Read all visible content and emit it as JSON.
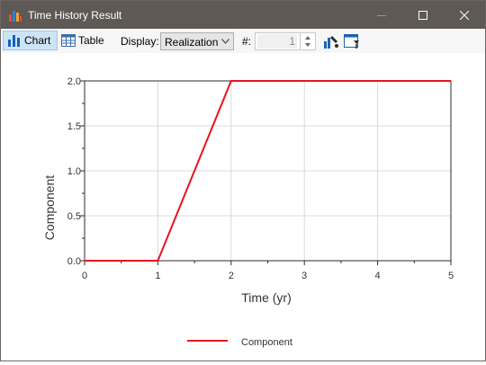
{
  "window": {
    "title": "Time History Result"
  },
  "toolbar": {
    "chart_label": "Chart",
    "table_label": "Table",
    "display_label": "Display:",
    "display_value": "Realization",
    "number_label": "#:",
    "number_value": "1"
  },
  "chart_data": {
    "type": "line",
    "title": "",
    "xlabel": "Time (yr)",
    "ylabel": "Component",
    "xlim": [
      0,
      5
    ],
    "ylim": [
      0,
      2
    ],
    "x_ticks": [
      "0",
      "1",
      "2",
      "3",
      "4",
      "5"
    ],
    "y_ticks": [
      "0.0",
      "0.5",
      "1.0",
      "1.5",
      "2.0"
    ],
    "grid": true,
    "legend_position": "bottom",
    "series": [
      {
        "name": "Component",
        "color": "#e8141e",
        "x": [
          0,
          1,
          2,
          5
        ],
        "y": [
          0,
          0,
          2,
          2
        ]
      }
    ]
  }
}
